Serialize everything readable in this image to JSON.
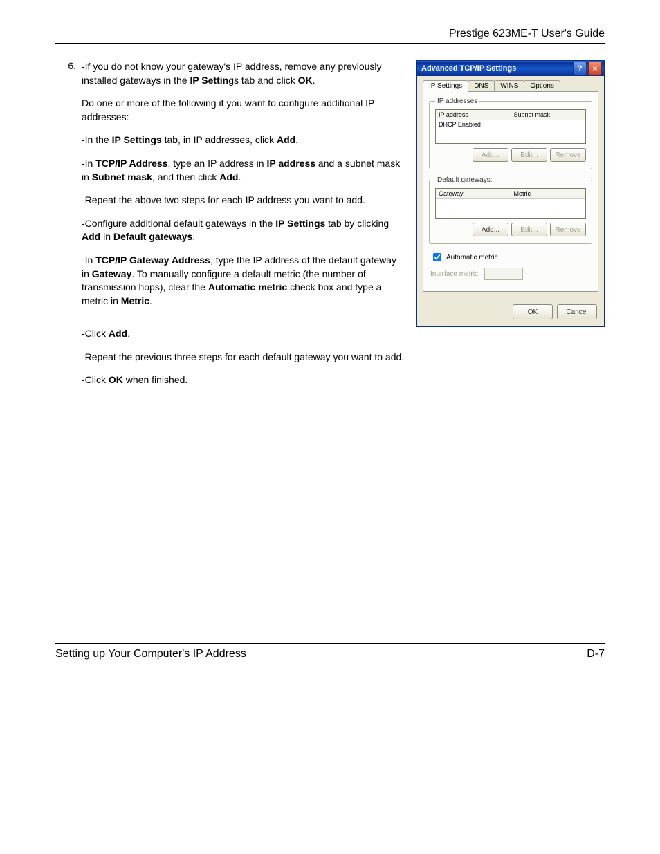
{
  "header": {
    "title": "Prestige 623ME-T User's Guide"
  },
  "step": {
    "number": "6.",
    "paragraphs": [
      {
        "segments": [
          {
            "t": "-If you do not know your gateway's IP address, remove any previously installed gateways in the "
          },
          {
            "t": "IP Settin",
            "b": true
          },
          {
            "t": "gs tab and click "
          },
          {
            "t": "OK",
            "b": true
          },
          {
            "t": "."
          }
        ]
      },
      {
        "segments": [
          {
            "t": "Do one or more of the following if you want to configure additional IP addresses:"
          }
        ]
      },
      {
        "segments": [
          {
            "t": "-In the "
          },
          {
            "t": "IP Settings",
            "b": true
          },
          {
            "t": " tab, in IP addresses, click "
          },
          {
            "t": "Add",
            "b": true
          },
          {
            "t": "."
          }
        ]
      },
      {
        "segments": [
          {
            "t": "-In "
          },
          {
            "t": "TCP/IP Address",
            "b": true
          },
          {
            "t": ", type an IP address in "
          },
          {
            "t": "IP address",
            "b": true
          },
          {
            "t": " and a subnet mask in "
          },
          {
            "t": "Subnet mask",
            "b": true
          },
          {
            "t": ", and then click "
          },
          {
            "t": "Add",
            "b": true
          },
          {
            "t": "."
          }
        ]
      },
      {
        "segments": [
          {
            "t": "-Repeat the above two steps for each IP address you want to add."
          }
        ]
      },
      {
        "segments": [
          {
            "t": "-Configure additional default gateways in the "
          },
          {
            "t": "IP Settings",
            "b": true
          },
          {
            "t": " tab by clicking "
          },
          {
            "t": "Add",
            "b": true
          },
          {
            "t": " in "
          },
          {
            "t": "Default gateways",
            "b": true
          },
          {
            "t": "."
          }
        ]
      },
      {
        "segments": [
          {
            "t": "-In "
          },
          {
            "t": "TCP/IP Gateway Address",
            "b": true
          },
          {
            "t": ", type the IP address of the default gateway in "
          },
          {
            "t": "Gateway",
            "b": true
          },
          {
            "t": ". To manually configure a default metric (the number of transmission hops), clear the "
          },
          {
            "t": "Automatic metric",
            "b": true
          },
          {
            "t": " check box and type a metric in "
          },
          {
            "t": "Metric",
            "b": true
          },
          {
            "t": "."
          }
        ]
      }
    ],
    "continued": [
      {
        "segments": [
          {
            "t": "-Click "
          },
          {
            "t": "Add",
            "b": true
          },
          {
            "t": "."
          }
        ]
      },
      {
        "segments": [
          {
            "t": "-Repeat the previous three steps for each default gateway you want to add."
          }
        ]
      },
      {
        "segments": [
          {
            "t": "-Click "
          },
          {
            "t": "OK",
            "b": true
          },
          {
            "t": " when finished."
          }
        ]
      }
    ]
  },
  "dialog": {
    "title": "Advanced TCP/IP Settings",
    "tabs": [
      "IP Settings",
      "DNS",
      "WINS",
      "Options"
    ],
    "group1": {
      "legend": "IP addresses",
      "cols": [
        "IP address",
        "Subnet mask"
      ],
      "row": "DHCP Enabled",
      "buttons": [
        "Add...",
        "Edit...",
        "Remove"
      ]
    },
    "group2": {
      "legend": "Default gateways:",
      "cols": [
        "Gateway",
        "Metric"
      ],
      "buttons": [
        "Add...",
        "Edit...",
        "Remove"
      ]
    },
    "auto_metric": "Automatic metric",
    "interface_metric": "Interface metric:",
    "footer": {
      "ok": "OK",
      "cancel": "Cancel"
    }
  },
  "footer": {
    "left": "Setting up Your Computer's IP Address",
    "right": "D-7"
  }
}
